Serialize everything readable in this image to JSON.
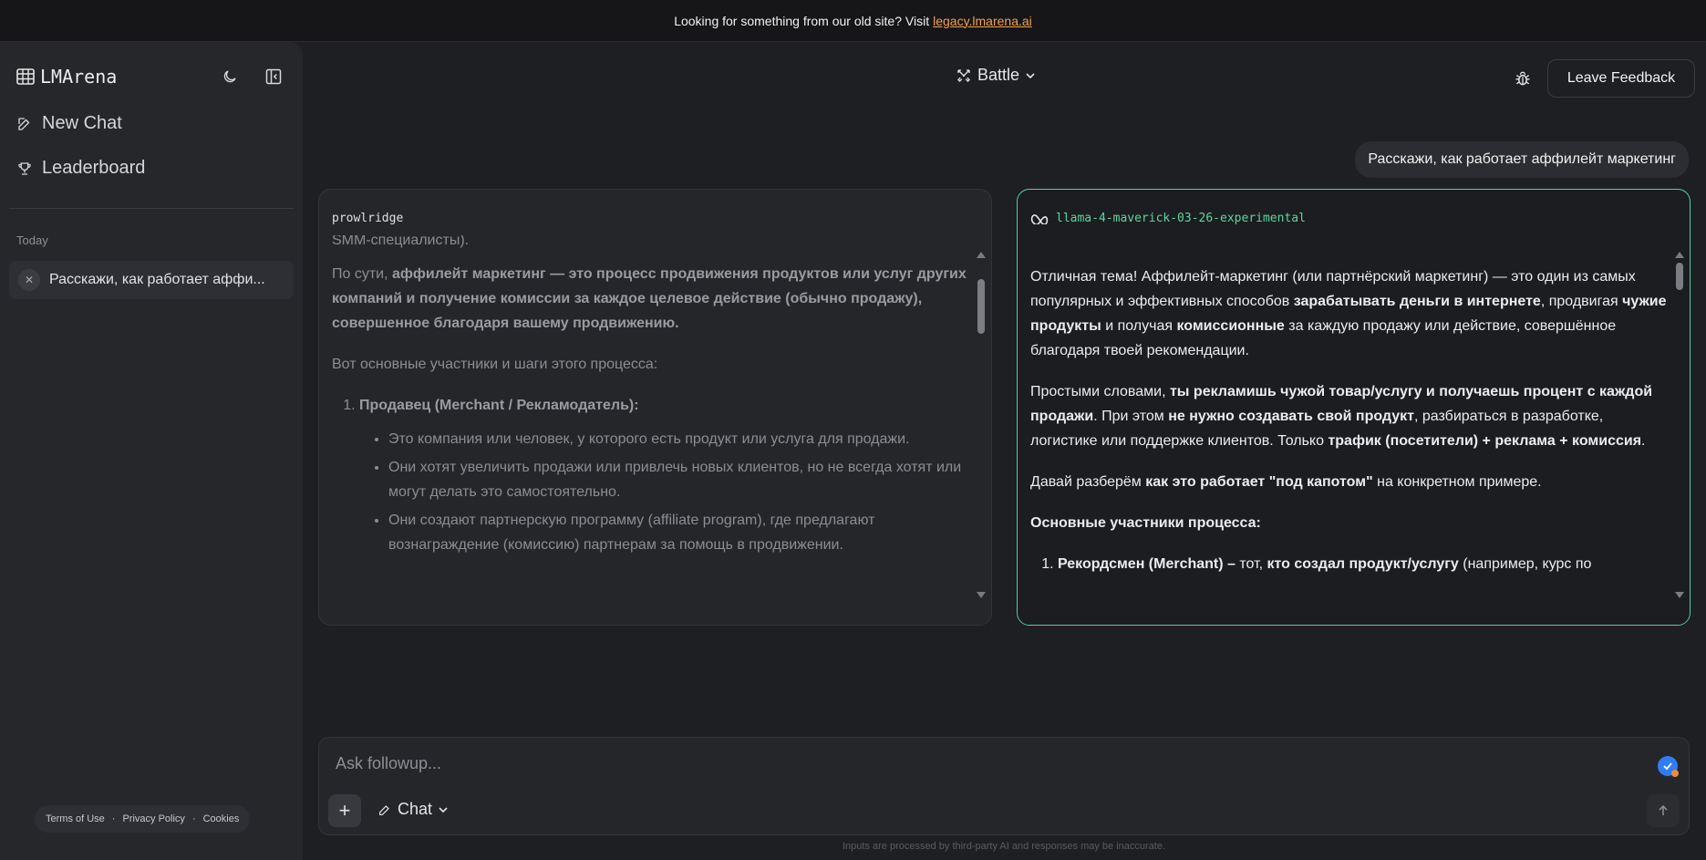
{
  "banner": {
    "text": "Looking for something from our old site? Visit",
    "link": "legacy.lmarena.ai"
  },
  "sidebar": {
    "brand": "LMArena",
    "nav": [
      {
        "label": "New Chat",
        "icon": "edit-icon"
      },
      {
        "label": "Leaderboard",
        "icon": "trophy-icon"
      }
    ],
    "section_label": "Today",
    "chats": [
      {
        "label": "Расскажи, как работает аффи..."
      }
    ],
    "footer": {
      "terms": "Terms of Use",
      "privacy": "Privacy Policy",
      "cookies": "Cookies",
      "sep": "·"
    }
  },
  "header": {
    "mode": "Battle",
    "feedback": "Leave Feedback"
  },
  "user_message": "Расскажи, как работает аффилейт маркетинг",
  "left_panel": {
    "model": "prowlridge",
    "cut_line": "SMM-специалисты).",
    "p1_pre": "По сути, ",
    "p1_bold": "аффилейт маркетинг — это процесс продвижения продуктов или услуг других компаний и получение комиссии за каждое целевое действие (обычно продажу), совершенное благодаря вашему продвижению.",
    "p2": "Вот основные участники и шаги этого процесса:",
    "item1_title": "Продавец (Merchant / Рекламодатель):",
    "item1_bullets": [
      "Это компания или человек, у которого есть продукт или услуга для продажи.",
      "Они хотят увеличить продажи или привлечь новых клиентов, но не всегда хотят или могут делать это самостоятельно.",
      "Они создают партнерскую программу (affiliate program), где предлагают вознаграждение (комиссию) партнерам за помощь в продвижении."
    ]
  },
  "right_panel": {
    "model": "llama-4-maverick-03-26-experimental",
    "p1_a": "Отличная тема! Аффилейт-маркетинг (или партнёрский маркетинг) — это один из самых популярных и эффективных способов ",
    "p1_b": "зарабатывать деньги в интернете",
    "p1_c": ", продвигая ",
    "p1_d": "чужие продукты",
    "p1_e": " и получая ",
    "p1_f": "комиссионные",
    "p1_g": " за каждую продажу или действие, совершённое благодаря твоей рекомендации.",
    "p2_a": "Простыми словами, ",
    "p2_b": "ты рекламишь чужой товар/услугу и получаешь процент с каждой продажи",
    "p2_c": ". При этом ",
    "p2_d": "не нужно создавать свой продукт",
    "p2_e": ", разбираться в разработке, логистике или поддержке клиентов. Только ",
    "p2_f": "трафик (посетители) + реклама + комиссия",
    "p2_g": ".",
    "p3_a": "Давай разберём ",
    "p3_b": "как это работает \"под капотом\"",
    "p3_c": " на конкретном примере.",
    "p4": "Основные участники процесса:",
    "item1_a": "Рекордсмен (Merchant) –",
    "item1_b": " тот, ",
    "item1_c": "кто создал продукт/услугу",
    "item1_d": " (например, курс по"
  },
  "input": {
    "placeholder": "Ask followup...",
    "mode": "Chat"
  },
  "disclaimer": "Inputs are processed by third-party AI and responses may be inaccurate.",
  "colors": {
    "accent_green": "#4fd1a1",
    "link_orange": "#f0a04b",
    "badge_blue": "#2f7df2"
  }
}
